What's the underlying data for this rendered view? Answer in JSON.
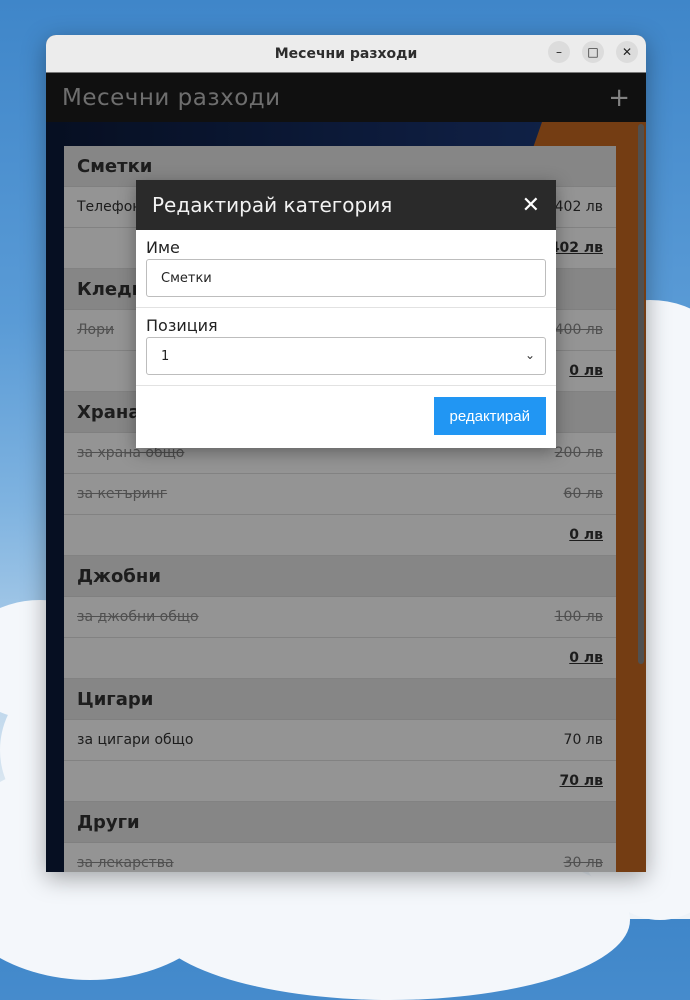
{
  "window": {
    "title": "Месечни разходи"
  },
  "appbar": {
    "title": "Месечни разходи",
    "add_icon": "+"
  },
  "categories": [
    {
      "name": "Сметки",
      "items": [
        {
          "label": "Телефон",
          "amount": "402 лв"
        }
      ],
      "total": "402 лв"
    },
    {
      "name": "Кледи",
      "items": [
        {
          "label": "Лори",
          "amount": "400 лв"
        }
      ],
      "total": "0 лв"
    },
    {
      "name": "Храна",
      "items": [
        {
          "label": "за храна общо",
          "amount": "200 лв"
        },
        {
          "label": "за кетъринг",
          "amount": "60 лв"
        }
      ],
      "total": "0 лв"
    },
    {
      "name": "Джобни",
      "items": [
        {
          "label": "за джобни общо",
          "amount": "100 лв"
        }
      ],
      "total": "0 лв"
    },
    {
      "name": "Цигари",
      "items": [
        {
          "label": "за цигари общо",
          "amount": "70 лв"
        }
      ],
      "total": "70 лв"
    },
    {
      "name": "Други",
      "items": [
        {
          "label": "за лекарства",
          "amount": "30 лв"
        }
      ],
      "total": ""
    }
  ],
  "modal": {
    "title": "Редактирай категория",
    "name_label": "Име",
    "name_value": "Сметки",
    "position_label": "Позиция",
    "position_value": "1",
    "submit_label": "редактирай"
  }
}
